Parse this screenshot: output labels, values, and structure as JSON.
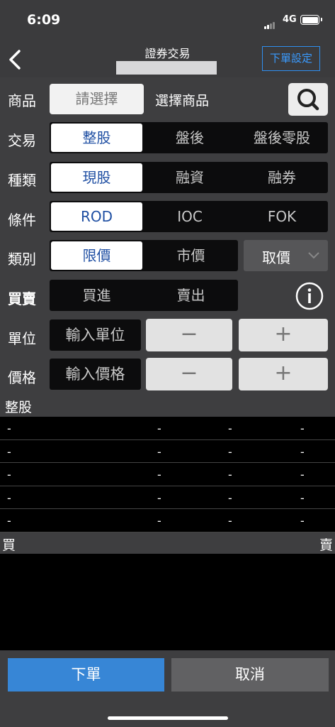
{
  "status": {
    "time": "6:09",
    "network": "4G"
  },
  "nav": {
    "title": "證券交易",
    "settings_label": "下單設定"
  },
  "product": {
    "label": "商品",
    "select_button": "請選擇",
    "select_text": "選擇商品"
  },
  "trade": {
    "label": "交易",
    "options": [
      "整股",
      "盤後",
      "盤後零股"
    ],
    "selected": 0
  },
  "kind": {
    "label": "種類",
    "options": [
      "現股",
      "融資",
      "融券"
    ],
    "selected": 0
  },
  "condition": {
    "label": "條件",
    "options": [
      "ROD",
      "IOC",
      "FOK"
    ],
    "selected": 0
  },
  "category": {
    "label": "類別",
    "options": [
      "限價",
      "市價"
    ],
    "selected": 0,
    "get_price": "取價"
  },
  "side": {
    "label": "買賣",
    "options": [
      "買進",
      "賣出"
    ]
  },
  "unit": {
    "label": "單位",
    "placeholder": "輸入單位",
    "minus": "−",
    "plus": "+"
  },
  "price": {
    "label": "價格",
    "placeholder": "輸入價格",
    "minus": "−",
    "plus": "+"
  },
  "quote": {
    "header": "整股",
    "rows": [
      [
        "-",
        "-",
        "-",
        "-"
      ],
      [
        "-",
        "-",
        "-",
        "-"
      ],
      [
        "-",
        "-",
        "-",
        "-"
      ],
      [
        "-",
        "-",
        "-",
        "-"
      ],
      [
        "-",
        "-",
        "-",
        "-"
      ]
    ]
  },
  "book": {
    "buy_label": "買",
    "sell_label": "賣"
  },
  "actions": {
    "order": "下單",
    "cancel": "取消"
  },
  "colors": {
    "accent": "#3786d6",
    "selected_text": "#1f4fa3",
    "link": "#3a9bff"
  }
}
